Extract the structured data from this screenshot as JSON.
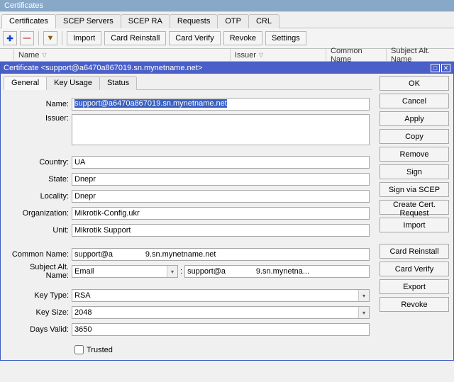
{
  "window": {
    "title": "Certificates"
  },
  "main_tabs": [
    "Certificates",
    "SCEP Servers",
    "SCEP RA",
    "Requests",
    "OTP",
    "CRL"
  ],
  "main_tabs_active": 0,
  "toolbar": {
    "import": "Import",
    "card_reinstall": "Card Reinstall",
    "card_verify": "Card Verify",
    "revoke": "Revoke",
    "settings": "Settings"
  },
  "columns": {
    "name": "Name",
    "issuer": "Issuer",
    "common_name": "Common Name",
    "san": "Subject Alt. Name"
  },
  "dialog": {
    "title": "Certificate <support@a6470a867019.sn.mynetname.net>",
    "inner_tabs": [
      "General",
      "Key Usage",
      "Status"
    ],
    "inner_tabs_active": 0,
    "labels": {
      "name": "Name:",
      "issuer": "Issuer:",
      "country": "Country:",
      "state": "State:",
      "locality": "Locality:",
      "organization": "Organization:",
      "unit": "Unit:",
      "common_name": "Common Name:",
      "san": "Subject Alt. Name:",
      "key_type": "Key Type:",
      "key_size": "Key Size:",
      "days_valid": "Days Valid:",
      "trusted": "Trusted"
    },
    "values": {
      "name": "support@a6470a867019.sn.mynetname.net",
      "issuer": "",
      "country": "UA",
      "state": "Dnepr",
      "locality": "Dnepr",
      "organization": "Mikrotik-Config.ukr",
      "unit": "Mikrotik Support",
      "common_name": "support@a               9.sn.mynetname.net",
      "san_type": "Email",
      "san_value": "support@a              9.sn.mynetna...",
      "key_type": "RSA",
      "key_size": "2048",
      "days_valid": "3650",
      "trusted": false
    },
    "buttons": {
      "ok": "OK",
      "cancel": "Cancel",
      "apply": "Apply",
      "copy": "Copy",
      "remove": "Remove",
      "sign": "Sign",
      "sign_scep": "Sign via SCEP",
      "create_csr": "Create Cert. Request",
      "import": "Import",
      "card_reinstall": "Card Reinstall",
      "card_verify": "Card Verify",
      "export": "Export",
      "revoke": "Revoke"
    }
  }
}
